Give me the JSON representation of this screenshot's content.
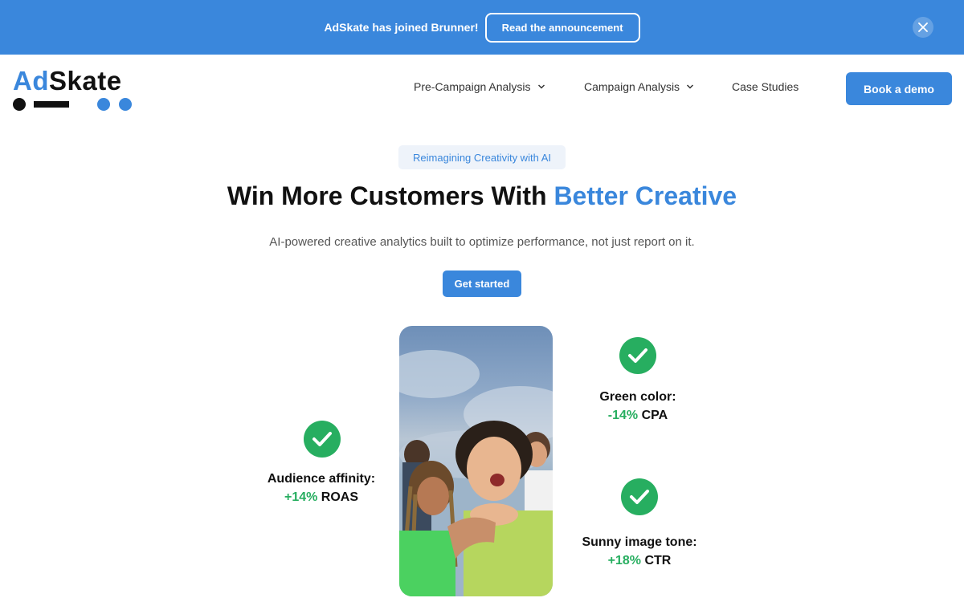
{
  "banner": {
    "message": "AdSkate has joined Brunner!",
    "button": "Read the announcement",
    "close_icon": "close-icon"
  },
  "logo": {
    "part1": "Ad",
    "part2": "Skate"
  },
  "nav": {
    "items": [
      {
        "label": "Pre-Campaign Analysis",
        "has_dropdown": true
      },
      {
        "label": "Campaign Analysis",
        "has_dropdown": true
      },
      {
        "label": "Case Studies",
        "has_dropdown": false
      }
    ],
    "demo_button": "Book a demo"
  },
  "hero": {
    "pill": "Reimagining Creativity with AI",
    "headline_main": "Win More Customers With ",
    "headline_accent": "Better Creative",
    "subhead": "AI-powered creative analytics built to optimize performance, not just report on it.",
    "cta": "Get started"
  },
  "stats": [
    {
      "label": "Audience affinity:",
      "value": "+14%",
      "metric": "ROAS"
    },
    {
      "label": "Green color:",
      "value": "-14%",
      "metric": "CPA"
    },
    {
      "label": "Sunny image tone:",
      "value": "+18%",
      "metric": "CTR"
    }
  ],
  "colors": {
    "brand_blue": "#3a87dc",
    "success_green": "#27ae60",
    "pill_bg": "#eef3fa"
  }
}
